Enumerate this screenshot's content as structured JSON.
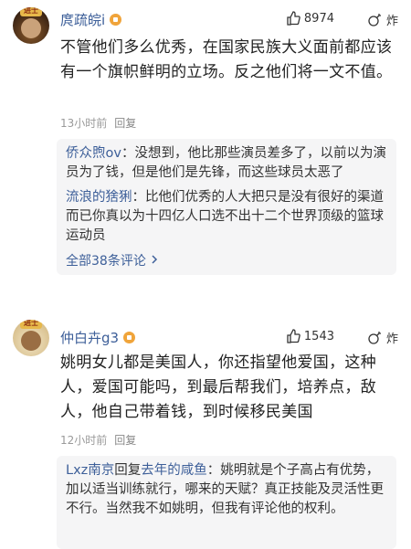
{
  "comments": [
    {
      "username": "庹疏皖i",
      "likes": "8974",
      "react_label": "炸",
      "text": "不管他们多么优秀，在国家民族大义面前都应该有一个旗帜鲜明的立场。反之他们将一文不值。",
      "time": "13小时前",
      "reply_label": "回复",
      "replies": [
        {
          "name": "侨众煦ov",
          "text": "没想到，他比那些演员差多了，以前以为演员为了钱，但是他们是先锋，而这些球员太恶了"
        },
        {
          "name": "流浪的猞猁",
          "text": "比他们优秀的人大把只是没有很好的渠道而已你真以为十四亿人口选不出十二个世界顶级的篮球运动员"
        }
      ],
      "more_label": "全部38条评论"
    },
    {
      "username": "仲白卉g3",
      "likes": "1543",
      "react_label": "炸",
      "text": "姚明女儿都是美国人，你还指望他爱国，这种人，爱国可能吗，到最后帮我们，培养点，敌人，他自己带着钱，到时候移民美国",
      "time": "12小时前",
      "reply_label": "回复",
      "replies": [
        {
          "name": "Lxz南京",
          "reply_word": "回复",
          "target": "去年的咸鱼",
          "text": "姚明就是个子高占有优势，加以适当训练就行，哪来的天赋？真正技能及灵活性更不行。当然我不如姚明，但我有评论他的权利。"
        }
      ]
    }
  ],
  "avatar_hat_text": "进士"
}
